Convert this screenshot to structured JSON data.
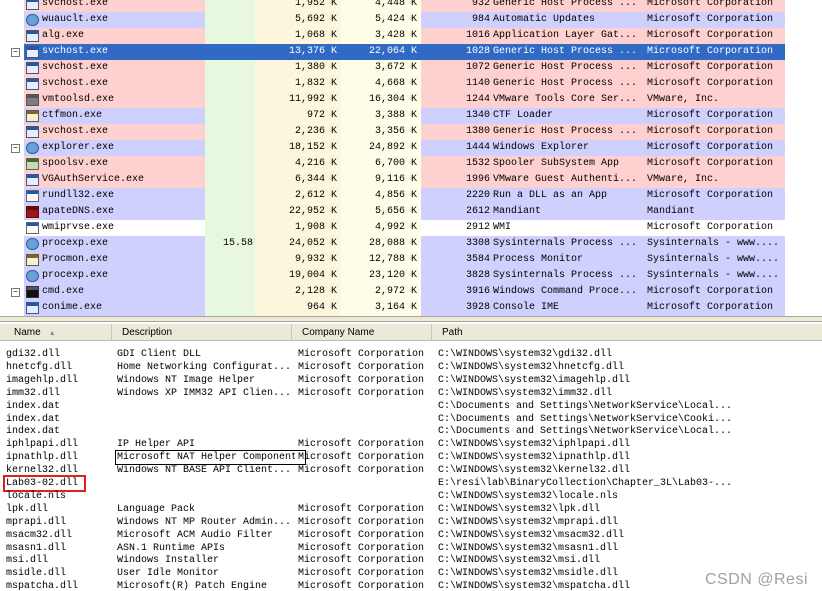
{
  "processes": [
    {
      "name": "svchost.exe",
      "cpu": "",
      "private": "1,952 K",
      "working": "4,448 K",
      "pid": "932",
      "description": "Generic Host Process ...",
      "company": "Microsoft Corporation",
      "icon": "service-window-icon",
      "tree": "",
      "bg": "#ffd0d0",
      "sel": false
    },
    {
      "name": "wuauclt.exe",
      "cpu": "",
      "private": "5,692 K",
      "working": "5,424 K",
      "pid": "984",
      "description": "Automatic Updates",
      "company": "Microsoft Corporation",
      "icon": "update-globe-icon",
      "tree": "",
      "bg": "#d0d0ff",
      "sel": false
    },
    {
      "name": "alg.exe",
      "cpu": "",
      "private": "1,068 K",
      "working": "3,428 K",
      "pid": "1016",
      "description": "Application Layer Gat...",
      "company": "Microsoft Corporation",
      "icon": "service-window-icon",
      "tree": "",
      "bg": "#ffd0d0",
      "sel": false
    },
    {
      "name": "svchost.exe",
      "cpu": "",
      "private": "13,376 K",
      "working": "22,064 K",
      "pid": "1028",
      "description": "Generic Host Process ...",
      "company": "Microsoft Corporation",
      "icon": "service-window-icon",
      "tree": "minus",
      "bg": "#316ac5",
      "sel": true
    },
    {
      "name": "svchost.exe",
      "cpu": "",
      "private": "1,380 K",
      "working": "3,672 K",
      "pid": "1072",
      "description": "Generic Host Process ...",
      "company": "Microsoft Corporation",
      "icon": "service-window-icon",
      "tree": "",
      "bg": "#ffd0d0",
      "sel": false
    },
    {
      "name": "svchost.exe",
      "cpu": "",
      "private": "1,832 K",
      "working": "4,668 K",
      "pid": "1140",
      "description": "Generic Host Process ...",
      "company": "Microsoft Corporation",
      "icon": "service-window-icon",
      "tree": "",
      "bg": "#ffd0d0",
      "sel": false
    },
    {
      "name": "vmtoolsd.exe",
      "cpu": "",
      "private": "11,992 K",
      "working": "16,304 K",
      "pid": "1244",
      "description": "VMware Tools Core Ser...",
      "company": "VMware, Inc.",
      "icon": "vmware-icon",
      "tree": "",
      "bg": "#ffd0d0",
      "sel": false
    },
    {
      "name": "ctfmon.exe",
      "cpu": "",
      "private": "972 K",
      "working": "3,388 K",
      "pid": "1340",
      "description": "CTF Loader",
      "company": "Microsoft Corporation",
      "icon": "notepad-pen-icon",
      "tree": "",
      "bg": "#d0d0ff",
      "sel": false
    },
    {
      "name": "svchost.exe",
      "cpu": "",
      "private": "2,236 K",
      "working": "3,356 K",
      "pid": "1380",
      "description": "Generic Host Process ...",
      "company": "Microsoft Corporation",
      "icon": "service-window-icon",
      "tree": "",
      "bg": "#ffd0d0",
      "sel": false
    },
    {
      "name": "explorer.exe",
      "cpu": "",
      "private": "18,152 K",
      "working": "24,892 K",
      "pid": "1444",
      "description": "Windows Explorer",
      "company": "Microsoft Corporation",
      "icon": "explorer-icon",
      "tree": "minus",
      "bg": "#d0d0ff",
      "sel": false
    },
    {
      "name": "spoolsv.exe",
      "cpu": "",
      "private": "4,216 K",
      "working": "6,700 K",
      "pid": "1532",
      "description": "Spooler SubSystem App",
      "company": "Microsoft Corporation",
      "icon": "printer-gear-icon",
      "tree": "",
      "bg": "#ffd0d0",
      "sel": false
    },
    {
      "name": "VGAuthService.exe",
      "cpu": "",
      "private": "6,344 K",
      "working": "9,116 K",
      "pid": "1996",
      "description": "VMware Guest Authenti...",
      "company": "VMware, Inc.",
      "icon": "service-window-icon",
      "tree": "",
      "bg": "#ffd0d0",
      "sel": false
    },
    {
      "name": "rundll32.exe",
      "cpu": "",
      "private": "2,612 K",
      "working": "4,856 K",
      "pid": "2220",
      "description": "Run a DLL as an App",
      "company": "Microsoft Corporation",
      "icon": "rundll-window-icon",
      "tree": "",
      "bg": "#d0d0ff",
      "sel": false
    },
    {
      "name": "apateDNS.exe",
      "cpu": "",
      "private": "22,952 K",
      "working": "5,656 K",
      "pid": "2612",
      "description": "Mandiant",
      "company": "Mandiant",
      "icon": "apatedns-icon",
      "tree": "",
      "bg": "#d0d0ff",
      "sel": false
    },
    {
      "name": "wmiprvse.exe",
      "cpu": "",
      "private": "1,908 K",
      "working": "4,992 K",
      "pid": "2912",
      "description": "WMI",
      "company": "Microsoft Corporation",
      "icon": "wmi-icon",
      "tree": "",
      "bg": "#ffffff",
      "sel": false
    },
    {
      "name": "procexp.exe",
      "cpu": "15.58",
      "private": "24,052 K",
      "working": "28,088 K",
      "pid": "3308",
      "description": "Sysinternals Process ...",
      "company": "Sysinternals - www....",
      "icon": "procexp-icon",
      "tree": "",
      "bg": "#d0d0ff",
      "sel": false
    },
    {
      "name": "Procmon.exe",
      "cpu": "",
      "private": "9,932 K",
      "working": "12,788 K",
      "pid": "3584",
      "description": "Process Monitor",
      "company": "Sysinternals - www....",
      "icon": "procmon-icon",
      "tree": "",
      "bg": "#d0d0ff",
      "sel": false
    },
    {
      "name": "procexp.exe",
      "cpu": "",
      "private": "19,004 K",
      "working": "23,120 K",
      "pid": "3828",
      "description": "Sysinternals Process ...",
      "company": "Sysinternals - www....",
      "icon": "procexp-icon",
      "tree": "",
      "bg": "#d0d0ff",
      "sel": false
    },
    {
      "name": "cmd.exe",
      "cpu": "",
      "private": "2,128 K",
      "working": "2,972 K",
      "pid": "3916",
      "description": "Windows Command Proce...",
      "company": "Microsoft Corporation",
      "icon": "cmd-icon",
      "tree": "minus",
      "bg": "#d0d0ff",
      "sel": false
    },
    {
      "name": "conime.exe",
      "cpu": "",
      "private": "964 K",
      "working": "3,164 K",
      "pid": "3928",
      "description": "Console IME",
      "company": "Microsoft Corporation",
      "icon": "service-window-icon",
      "tree": "",
      "bg": "#d0d0ff",
      "sel": false
    }
  ],
  "dll_header": {
    "name": "Name",
    "description": "Description",
    "company": "Company Name",
    "path": "Path"
  },
  "dlls": [
    {
      "name": "gdi32.dll",
      "description": "GDI Client DLL",
      "company": "Microsoft Corporation",
      "path": "C:\\WINDOWS\\system32\\gdi32.dll"
    },
    {
      "name": "hnetcfg.dll",
      "description": "Home Networking Configurat...",
      "company": "Microsoft Corporation",
      "path": "C:\\WINDOWS\\system32\\hnetcfg.dll"
    },
    {
      "name": "imagehlp.dll",
      "description": "Windows NT Image Helper",
      "company": "Microsoft Corporation",
      "path": "C:\\WINDOWS\\system32\\imagehlp.dll"
    },
    {
      "name": "imm32.dll",
      "description": "Windows XP IMM32 API Clien...",
      "company": "Microsoft Corporation",
      "path": "C:\\WINDOWS\\system32\\imm32.dll"
    },
    {
      "name": "index.dat",
      "description": "",
      "company": "",
      "path": "C:\\Documents and Settings\\NetworkService\\Local..."
    },
    {
      "name": "index.dat",
      "description": "",
      "company": "",
      "path": "C:\\Documents and Settings\\NetworkService\\Cooki..."
    },
    {
      "name": "index.dat",
      "description": "",
      "company": "",
      "path": "C:\\Documents and Settings\\NetworkService\\Local..."
    },
    {
      "name": "iphlpapi.dll",
      "description": "IP Helper API",
      "company": "Microsoft Corporation",
      "path": "C:\\WINDOWS\\system32\\iphlpapi.dll"
    },
    {
      "name": "ipnathlp.dll",
      "description": "Microsoft NAT Helper Components",
      "company": "Microsoft Corporation",
      "path": "C:\\WINDOWS\\system32\\ipnathlp.dll"
    },
    {
      "name": "kernel32.dll",
      "description": "Windows NT BASE API Client...",
      "company": "Microsoft Corporation",
      "path": "C:\\WINDOWS\\system32\\kernel32.dll"
    },
    {
      "name": "Lab03-02.dll",
      "description": "",
      "company": "",
      "path": "E:\\resi\\lab\\BinaryCollection\\Chapter_3L\\Lab03-..."
    },
    {
      "name": "locale.nls",
      "description": "",
      "company": "",
      "path": "C:\\WINDOWS\\system32\\locale.nls"
    },
    {
      "name": "lpk.dll",
      "description": "Language Pack",
      "company": "Microsoft Corporation",
      "path": "C:\\WINDOWS\\system32\\lpk.dll"
    },
    {
      "name": "mprapi.dll",
      "description": "Windows NT MP Router Admin...",
      "company": "Microsoft Corporation",
      "path": "C:\\WINDOWS\\system32\\mprapi.dll"
    },
    {
      "name": "msacm32.dll",
      "description": "Microsoft ACM Audio Filter",
      "company": "Microsoft Corporation",
      "path": "C:\\WINDOWS\\system32\\msacm32.dll"
    },
    {
      "name": "msasn1.dll",
      "description": "ASN.1 Runtime APIs",
      "company": "Microsoft Corporation",
      "path": "C:\\WINDOWS\\system32\\msasn1.dll"
    },
    {
      "name": "msi.dll",
      "description": "Windows Installer",
      "company": "Microsoft Corporation",
      "path": "C:\\WINDOWS\\system32\\msi.dll"
    },
    {
      "name": "msidle.dll",
      "description": "User Idle Monitor",
      "company": "Microsoft Corporation",
      "path": "C:\\WINDOWS\\system32\\msidle.dll"
    },
    {
      "name": "mspatcha.dll",
      "description": "Microsoft(R) Patch Engine",
      "company": "Microsoft Corporation",
      "path": "C:\\WINDOWS\\system32\\mspatcha.dll"
    }
  ],
  "tooltip_row_index": 8,
  "highlighted_row_index": 10,
  "watermark": "CSDN @Resi",
  "colors": {
    "service": "#ffd0d0",
    "own_process": "#d0d0ff",
    "selected": "#316ac5",
    "highlight_box": "#e02020"
  }
}
